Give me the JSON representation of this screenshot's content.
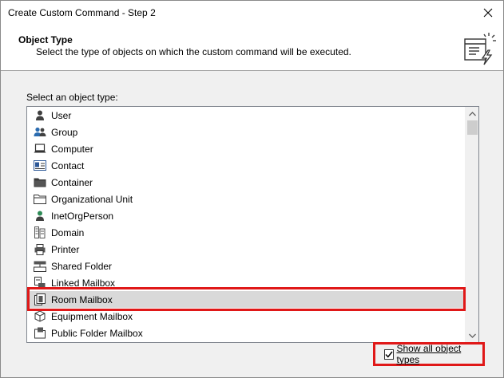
{
  "window": {
    "title": "Create Custom Command - Step 2",
    "close_icon": "close-icon"
  },
  "header": {
    "title": "Object Type",
    "description": "Select the type of objects on which the custom command will be executed.",
    "icon": "custom-command-wizard-icon"
  },
  "list": {
    "label": "Select an object type:",
    "selected_index": 11,
    "items": [
      {
        "label": "User",
        "icon": "user-icon"
      },
      {
        "label": "Group",
        "icon": "group-icon"
      },
      {
        "label": "Computer",
        "icon": "computer-icon"
      },
      {
        "label": "Contact",
        "icon": "contact-icon"
      },
      {
        "label": "Container",
        "icon": "folder-icon"
      },
      {
        "label": "Organizational Unit",
        "icon": "ou-folder-icon"
      },
      {
        "label": "InetOrgPerson",
        "icon": "inetorgperson-icon"
      },
      {
        "label": "Domain",
        "icon": "domain-icon"
      },
      {
        "label": "Printer",
        "icon": "printer-icon"
      },
      {
        "label": "Shared Folder",
        "icon": "shared-folder-icon"
      },
      {
        "label": "Linked Mailbox",
        "icon": "linked-mailbox-icon"
      },
      {
        "label": "Room Mailbox",
        "icon": "room-mailbox-icon"
      },
      {
        "label": "Equipment Mailbox",
        "icon": "equipment-mailbox-icon"
      },
      {
        "label": "Public Folder Mailbox",
        "icon": "public-folder-mailbox-icon"
      }
    ]
  },
  "show_all": {
    "label": "Show all object types",
    "checked": true
  },
  "colors": {
    "highlight": "#e01818",
    "selection": "#d9d9d9",
    "user_icon": "#404040",
    "group_icon": "#2b6cb0",
    "inetorgperson_icon": "#2e8b57"
  }
}
